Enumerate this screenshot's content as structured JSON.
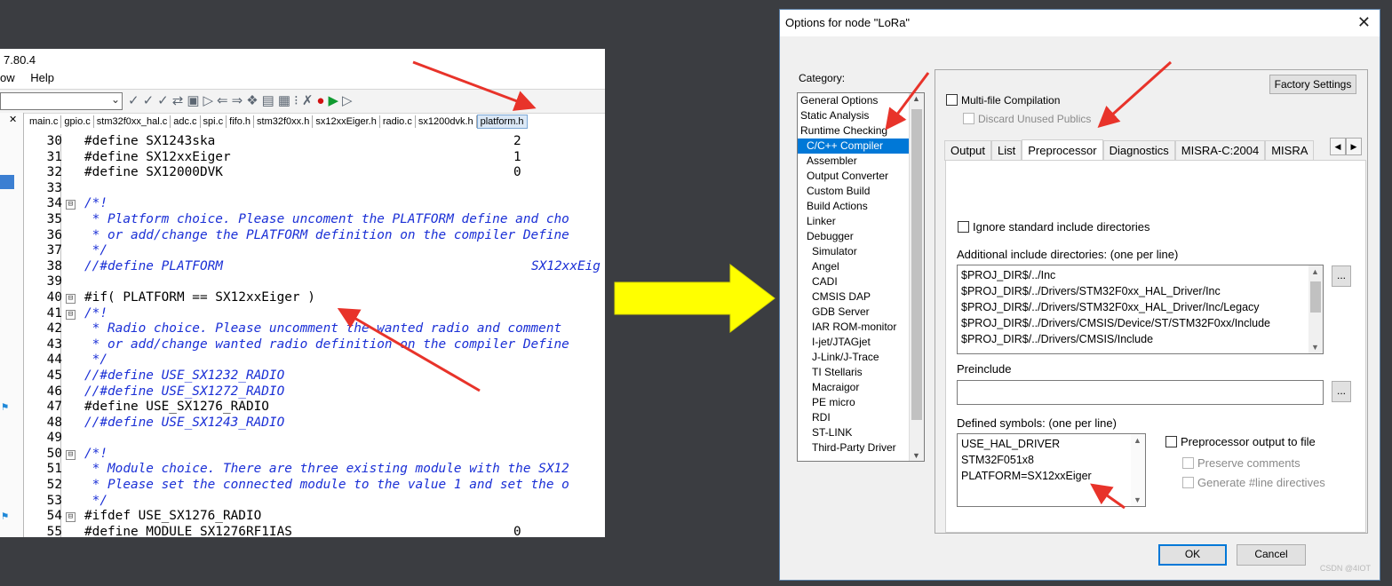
{
  "ide": {
    "version": "7.80.4",
    "menu": [
      "ow",
      "Help"
    ],
    "tabs": [
      "main.c",
      "gpio.c",
      "stm32f0xx_hal.c",
      "adc.c",
      "spi.c",
      "fifo.h",
      "stm32f0xx.h",
      "sx12xxEiger.h",
      "radio.c",
      "sx1200dvk.h",
      "platform.h"
    ],
    "active_tab": "platform.h",
    "lines": [
      {
        "n": "30",
        "code": "#define SX1243ska",
        "val": "2"
      },
      {
        "n": "31",
        "code": "#define SX12xxEiger",
        "val": "1"
      },
      {
        "n": "32",
        "code": "#define SX12000DVK",
        "val": "0"
      },
      {
        "n": "33",
        "code": ""
      },
      {
        "n": "34",
        "code": "/*!",
        "comment": true,
        "fold": "⊟"
      },
      {
        "n": "35",
        "code": " * Platform choice. Please uncoment the PLATFORM define and cho",
        "comment": true
      },
      {
        "n": "36",
        "code": " * or add/change the PLATFORM definition on the compiler Define",
        "comment": true
      },
      {
        "n": "37",
        "code": " */",
        "comment": true
      },
      {
        "n": "38",
        "code": "//#define PLATFORM",
        "comment": true,
        "cval": "SX12xxEig"
      },
      {
        "n": "39",
        "code": ""
      },
      {
        "n": "40",
        "code": "#if( PLATFORM == SX12xxEiger )",
        "fold": "⊟"
      },
      {
        "n": "41",
        "code": "/*!",
        "comment": true,
        "fold": "⊟"
      },
      {
        "n": "42",
        "code": " * Radio choice. Please uncomment the wanted radio and comment",
        "comment": true
      },
      {
        "n": "43",
        "code": " * or add/change wanted radio definition on the compiler Define",
        "comment": true
      },
      {
        "n": "44",
        "code": " */",
        "comment": true
      },
      {
        "n": "45",
        "code": "//#define USE_SX1232_RADIO",
        "comment": true
      },
      {
        "n": "46",
        "code": "//#define USE_SX1272_RADIO",
        "comment": true
      },
      {
        "n": "47",
        "code": "#define USE_SX1276_RADIO",
        "bookmark": true
      },
      {
        "n": "48",
        "code": "//#define USE_SX1243_RADIO",
        "comment": true
      },
      {
        "n": "49",
        "code": ""
      },
      {
        "n": "50",
        "code": "/*!",
        "comment": true,
        "fold": "⊟"
      },
      {
        "n": "51",
        "code": " * Module choice. There are three existing module with the SX12",
        "comment": true
      },
      {
        "n": "52",
        "code": " * Please set the connected module to the value 1 and set the o",
        "comment": true
      },
      {
        "n": "53",
        "code": " */",
        "comment": true
      },
      {
        "n": "54",
        "code": "#ifdef USE_SX1276_RADIO",
        "fold": "⊟",
        "bookmark": true
      },
      {
        "n": "55",
        "code": "#define MODULE_SX1276RF1IAS",
        "val": "0"
      }
    ]
  },
  "dialog": {
    "title": "Options for node \"LoRa\"",
    "category_label": "Category:",
    "categories": [
      {
        "label": "General Options",
        "level": 0
      },
      {
        "label": "Static Analysis",
        "level": 0
      },
      {
        "label": "Runtime Checking",
        "level": 0
      },
      {
        "label": "C/C++ Compiler",
        "level": 1,
        "selected": true
      },
      {
        "label": "Assembler",
        "level": 1
      },
      {
        "label": "Output Converter",
        "level": 1
      },
      {
        "label": "Custom Build",
        "level": 1
      },
      {
        "label": "Build Actions",
        "level": 1
      },
      {
        "label": "Linker",
        "level": 1
      },
      {
        "label": "Debugger",
        "level": 1
      },
      {
        "label": "Simulator",
        "level": 2
      },
      {
        "label": "Angel",
        "level": 2
      },
      {
        "label": "CADI",
        "level": 2
      },
      {
        "label": "CMSIS DAP",
        "level": 2
      },
      {
        "label": "GDB Server",
        "level": 2
      },
      {
        "label": "IAR ROM-monitor",
        "level": 2
      },
      {
        "label": "I-jet/JTAGjet",
        "level": 2
      },
      {
        "label": "J-Link/J-Trace",
        "level": 2
      },
      {
        "label": "TI Stellaris",
        "level": 2
      },
      {
        "label": "Macraigor",
        "level": 2
      },
      {
        "label": "PE micro",
        "level": 2
      },
      {
        "label": "RDI",
        "level": 2
      },
      {
        "label": "ST-LINK",
        "level": 2
      },
      {
        "label": "Third-Party Driver",
        "level": 2
      }
    ],
    "factory_settings": "Factory Settings",
    "multifile": "Multi-file Compilation",
    "discard_unused": "Discard Unused Publics",
    "tabs": [
      "Output",
      "List",
      "Preprocessor",
      "Diagnostics",
      "MISRA-C:2004",
      "MISRA"
    ],
    "active_tab": "Preprocessor",
    "ignore_std": "Ignore standard include directories",
    "include_label": "Additional include directories: (one per line)",
    "include_dirs": [
      "$PROJ_DIR$/../Inc",
      "$PROJ_DIR$/../Drivers/STM32F0xx_HAL_Driver/Inc",
      "$PROJ_DIR$/../Drivers/STM32F0xx_HAL_Driver/Inc/Legacy",
      "$PROJ_DIR$/../Drivers/CMSIS/Device/ST/STM32F0xx/Include",
      "$PROJ_DIR$/../Drivers/CMSIS/Include"
    ],
    "preinclude_label": "Preinclude",
    "preinclude_value": "",
    "browse": "...",
    "defined_label": "Defined symbols: (one per line)",
    "defined_symbols": [
      "USE_HAL_DRIVER",
      "STM32F051x8",
      "PLATFORM=SX12xxEiger"
    ],
    "pp_output": "Preprocessor output to file",
    "preserve_comments": "Preserve comments",
    "generate_line": "Generate #line directives",
    "ok": "OK",
    "cancel": "Cancel",
    "close_glyph": "✕"
  },
  "watermark": "CSDN @4IOT",
  "colors": {
    "annotation_red": "#e8332a",
    "arrow_yellow": "#ffff00",
    "selection_blue": "#0078d7",
    "comment_blue": "#1a2fd6"
  }
}
